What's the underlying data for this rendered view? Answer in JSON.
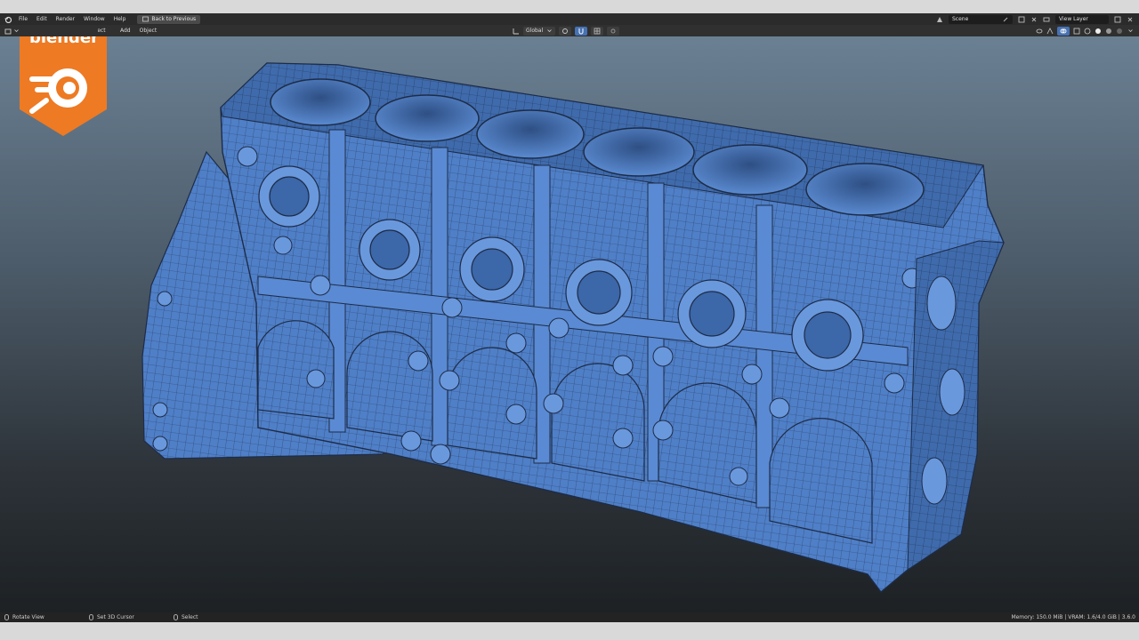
{
  "topbar": {
    "menus": [
      "File",
      "Edit",
      "Render",
      "Window",
      "Help"
    ],
    "back_button": "Back to Previous",
    "scene": "Scene",
    "view_layer": "View Layer"
  },
  "header": {
    "menus": [
      "Object",
      "Add",
      "Object"
    ],
    "transform_orientation": "Global"
  },
  "logo": {
    "wordmark": "blender",
    "color": "#ee7a23"
  },
  "status": {
    "hints": [
      "Rotate View",
      "Set 3D Cursor",
      "Select"
    ],
    "info": "Memory: 150.0 MiB | VRAM: 1.6/4.0 GiB | 3.6.0"
  },
  "colors": {
    "mesh": "#4f7fc7",
    "mesh_dark": "#355c99",
    "accent": "#4772b3"
  }
}
